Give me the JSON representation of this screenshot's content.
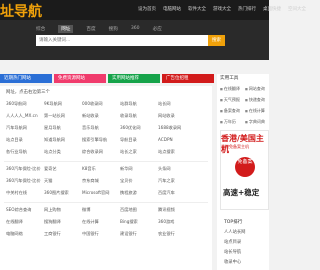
{
  "header": {
    "logo_text": "址导航",
    "nav": [
      "设为首页",
      "电脑网站",
      "软件大全",
      "游戏大全",
      "热门排行",
      "桌面快捷",
      "空间大全"
    ]
  },
  "search": {
    "tabs": [
      "综合",
      "网址",
      "百度",
      "搜狗",
      "360",
      "必应"
    ],
    "active_tab": "网址",
    "placeholder": "请输入关键词...",
    "button_label": "搜索"
  },
  "banners": [
    {
      "label": "近期热门网站",
      "color": "#2b6fd6"
    },
    {
      "label": "免费资源网站",
      "color": "#f03b6c"
    },
    {
      "label": "实用网站推荐",
      "color": "#16a34a"
    },
    {
      "label": "广告位招租",
      "color": "#d21b1b"
    }
  ],
  "main": {
    "hint": "网址，点击右边第三个",
    "rows": [
      [
        "360导航网",
        "9K导航网",
        "000收录网",
        "站群导航",
        "站长网"
      ],
      [
        "人人人人_MX.cn",
        "第一站长网",
        "新站收录",
        "收录导航",
        "网站收录"
      ],
      [
        "汽车导航网",
        "星月导航",
        "音乐导航",
        "360优化网",
        "1688收录网"
      ],
      [
        "站点目录",
        "知道导航网",
        "搜索引擎导航",
        "导航目录",
        "ACDPN"
      ],
      [
        "各行业导航",
        "站点分类",
        "综合收录网",
        "站长之家",
        "站点搜索"
      ],
      [
        "360汽车保险-比价",
        "爱奇艺",
        "K8音乐",
        "新华网",
        "头条网"
      ],
      [
        "360汽车保险-比价",
        "天猫",
        "京东商城",
        "宝贝价",
        "汽车之家"
      ],
      [
        "中关村在线",
        "360图片搜索",
        "Microsoft官网",
        "携程旅游",
        "百度汽车"
      ],
      [
        "SEO综合查询",
        "网上购物",
        "微博",
        "百度地图",
        "腾讯视频"
      ],
      [
        "在线翻译",
        "搜狗翻译",
        "在线计算",
        "Bing搜索",
        "360游戏"
      ],
      [
        "电脑网络",
        "工商银行",
        "中国银行",
        "建设银行",
        "农业银行"
      ]
    ]
  },
  "sidebar": {
    "title": "实用工具",
    "items": [
      "在线翻译",
      "网站查询",
      "天气预报",
      "快递查询",
      "备案查询",
      "在线计算",
      "万年历",
      "字典词典"
    ],
    "ad": {
      "line1": "香港/美国主机",
      "line2": "香港免备案主机",
      "badge": "免备案",
      "line3": "高速+稳定"
    },
    "top_label": "TOP排行",
    "top_items": [
      "人人站长网",
      "站点目录",
      "站长导航",
      "收录中心"
    ]
  }
}
